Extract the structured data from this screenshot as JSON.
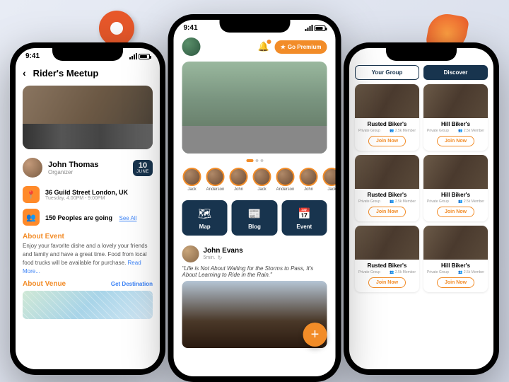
{
  "status": {
    "time_left": "9:41",
    "time_center": "9:41"
  },
  "left": {
    "title": "Rider's Meetup",
    "organizer": {
      "name": "John Thomas",
      "role": "Organizer"
    },
    "date": {
      "day": "10",
      "month": "JUNE"
    },
    "location": {
      "address": "36 Guild Street London, UK",
      "time": "Tuesday, 4.00PM - 9:00PM"
    },
    "attendance": {
      "count": "150 Peoples are going",
      "see_all": "See All"
    },
    "about_title": "About Event",
    "about_text": "Enjoy your favorite dishe and a lovely your friends and family and have a great time. Food from local food trucks will be available for purchase.",
    "read_more": "Read More...",
    "venue_title": "About Venue",
    "get_destination": "Get Destination"
  },
  "center": {
    "premium": "Go Premium",
    "stories": [
      {
        "name": "Jack"
      },
      {
        "name": "Anderson"
      },
      {
        "name": "John"
      },
      {
        "name": "Jack"
      },
      {
        "name": "Anderson"
      },
      {
        "name": "John"
      },
      {
        "name": "Jack"
      }
    ],
    "nav": {
      "map": "Map",
      "blog": "Blog",
      "event": "Event"
    },
    "post": {
      "author": "John Evans",
      "time": "5min.",
      "quote": "\"Life is Not About Waiting for the Storms to Pass, It's About Learning to Ride in the Rain.\""
    }
  },
  "right": {
    "tabs": {
      "your_group": "Your Group",
      "discover": "Discover"
    },
    "groups": [
      {
        "name": "Rusted Biker's",
        "type": "Private Group",
        "members": "2.5k Member",
        "cta": "Join Now"
      },
      {
        "name": "Hill Biker's",
        "type": "Private Group",
        "members": "2.5k Member",
        "cta": "Join Now"
      },
      {
        "name": "Rusted Biker's",
        "type": "Private Group",
        "members": "2.5k Member",
        "cta": "Join Now"
      },
      {
        "name": "Hill Biker's",
        "type": "Private Group",
        "members": "2.5k Member",
        "cta": "Join Now"
      },
      {
        "name": "Rusted Biker's",
        "type": "Private Group",
        "members": "2.5k Member",
        "cta": "Join Now"
      },
      {
        "name": "Hill Biker's",
        "type": "Private Group",
        "members": "2.5k Member",
        "cta": "Join Now"
      }
    ]
  }
}
